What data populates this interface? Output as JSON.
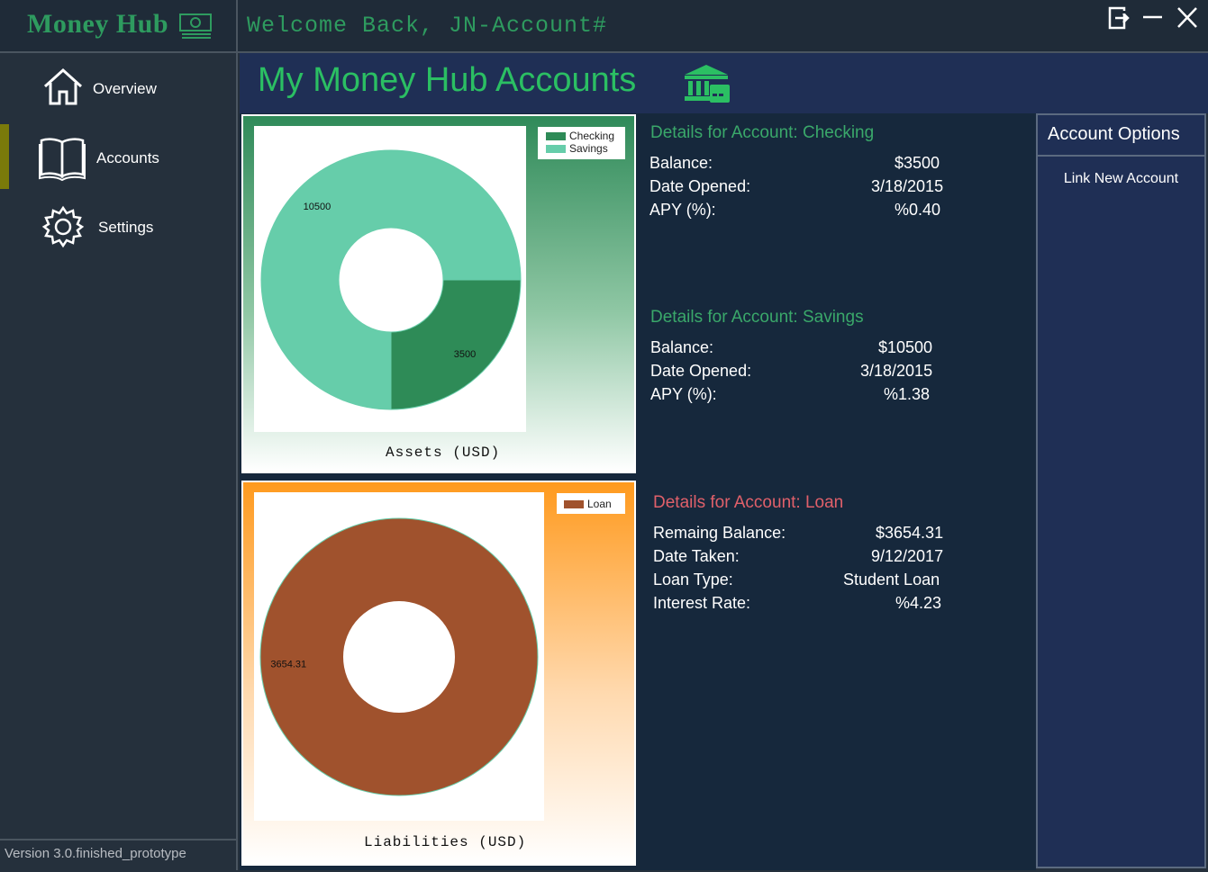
{
  "app": {
    "brand": "Money Hub",
    "welcome": "Welcome Back, JN-Account#",
    "version": "Version 3.0.finished_prototype"
  },
  "sidebar": {
    "items": [
      {
        "label": "Overview",
        "icon": "home-icon"
      },
      {
        "label": "Accounts",
        "icon": "book-icon",
        "active": true
      },
      {
        "label": "Settings",
        "icon": "gear-icon"
      }
    ]
  },
  "window_controls": [
    "logout-icon",
    "minimize-icon",
    "close-icon"
  ],
  "header": {
    "title": "My Money Hub Accounts",
    "icon": "bank-icon"
  },
  "colors": {
    "brand_green": "#2e9b5f",
    "checking": "#2e8b57",
    "savings": "#66cdaa",
    "loan": "#a0522d",
    "asset_detail_title": "#3aa86a",
    "liability_detail_title": "#e0606a",
    "active_indicator": "#7a7a0a"
  },
  "assets": {
    "caption": "Assets (USD)",
    "legend": [
      "Checking",
      "Savings"
    ],
    "slice_labels": [
      "3500",
      "10500"
    ]
  },
  "liabilities": {
    "caption": "Liabilities (USD)",
    "legend": [
      "Loan"
    ],
    "slice_labels": [
      "3654.31"
    ]
  },
  "chart_data": [
    {
      "type": "pie",
      "xlabel": "Assets (USD)",
      "categories": [
        "Checking",
        "Savings"
      ],
      "values": [
        3500,
        10500
      ],
      "legend_position": "top-right"
    },
    {
      "type": "pie",
      "xlabel": "Liabilities (USD)",
      "categories": [
        "Loan"
      ],
      "values": [
        3654.31
      ],
      "legend_position": "top-right"
    }
  ],
  "details": {
    "checking": {
      "title": "Details for Account: Checking",
      "rows": [
        {
          "label": "Balance:",
          "value": "$3500"
        },
        {
          "label": "Date Opened:",
          "value": "3/18/2015"
        },
        {
          "label": "APY (%):",
          "value": "%0.40"
        }
      ]
    },
    "savings": {
      "title": "Details for Account: Savings",
      "rows": [
        {
          "label": "Balance:",
          "value": "$10500"
        },
        {
          "label": "Date Opened:",
          "value": "3/18/2015"
        },
        {
          "label": "APY (%):",
          "value": "%1.38"
        }
      ]
    },
    "loan": {
      "title": "Details for Account: Loan",
      "rows": [
        {
          "label": "Remaing Balance:",
          "value": "$3654.31"
        },
        {
          "label": "Date Taken:",
          "value": "9/12/2017"
        },
        {
          "label": "Loan Type:",
          "value": "Student Loan"
        },
        {
          "label": "Interest Rate:",
          "value": "%4.23"
        }
      ]
    }
  },
  "options": {
    "title": "Account Options",
    "link_account": "Link New Account"
  }
}
